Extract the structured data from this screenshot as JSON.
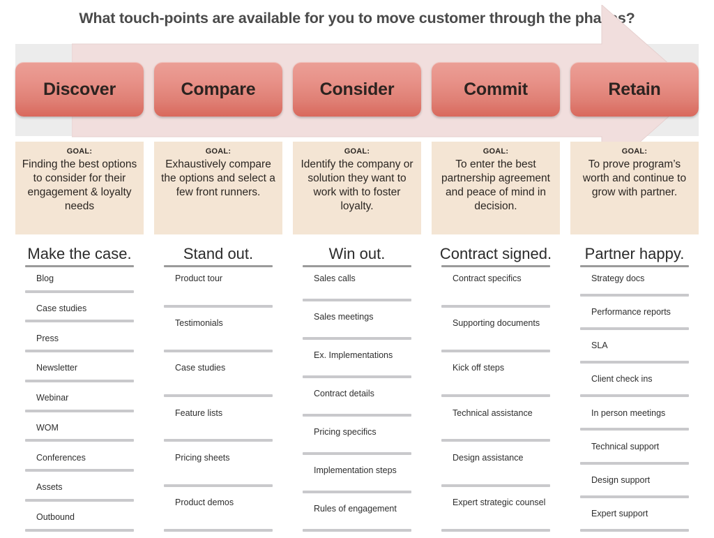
{
  "title": "What touch-points are available for you to move customer through the phases?",
  "colors": {
    "accent": "#df7f74",
    "goal_box": "#f4e5d4",
    "band": "#ececec",
    "arrow": "#f0dcdb",
    "rule": "#c9c9cc",
    "head_rule": "#9a9a9a",
    "title_text": "#4a4a4a"
  },
  "goal_label": "GOAL:",
  "phases": [
    {
      "name": "Discover",
      "goal": "Finding the best options to consider for their engagement & loyalty needs",
      "heading": "Make the case.",
      "items": [
        "Blog",
        "Case studies",
        "Press",
        "Newsletter",
        "Webinar",
        "WOM",
        "Conferences",
        "Assets",
        "Outbound"
      ]
    },
    {
      "name": "Compare",
      "goal": "Exhaustively compare the options and select a few front runners.",
      "heading": "Stand out.",
      "items": [
        "Product tour",
        "Testimonials",
        "Case studies",
        "Feature lists",
        "Pricing sheets",
        "Product demos"
      ]
    },
    {
      "name": "Consider",
      "goal": "Identify the company or solution they want to work with to foster loyalty.",
      "heading": "Win out.",
      "items": [
        "Sales calls",
        "Sales meetings",
        "Ex. Implementations",
        "Contract details",
        "Pricing specifics",
        "Implementation steps",
        "Rules of engagement"
      ]
    },
    {
      "name": "Commit",
      "goal": "To enter the best partnership agreement and peace of mind in decision.",
      "heading": "Contract signed.",
      "items": [
        "Contract specifics",
        "Supporting documents",
        "Kick off steps",
        "Technical assistance",
        "Design assistance",
        "Expert strategic counsel"
      ]
    },
    {
      "name": "Retain",
      "goal": "To prove program’s worth and continue to grow with partner.",
      "heading": "Partner happy.",
      "items": [
        "Strategy docs",
        "Performance reports",
        "SLA",
        "Client check ins",
        "In person meetings",
        "Technical support",
        "Design support",
        "Expert support"
      ]
    }
  ]
}
